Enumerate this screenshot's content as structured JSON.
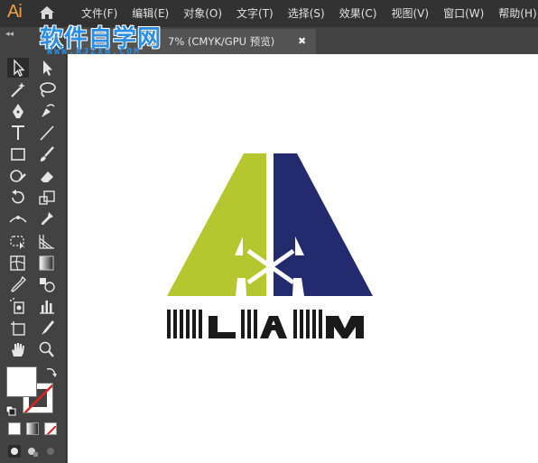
{
  "app": {
    "logo_text": "Ai"
  },
  "menu": {
    "items": [
      "文件(F)",
      "编辑(E)",
      "对象(O)",
      "文字(T)",
      "选择(S)",
      "效果(C)",
      "视图(V)",
      "窗口(W)",
      "帮助(H)"
    ]
  },
  "watermark": {
    "title": "软件自学网",
    "url": "WWW.RJZXW.COM"
  },
  "document_tab": {
    "title": "7% (CMYK/GPU 预览)",
    "close": "✖"
  },
  "panel": {
    "collapse": "◂◂"
  },
  "logo_artwork": {
    "text": "LIAM",
    "colors": {
      "green": "#b5c62e",
      "navy": "#232a6e",
      "black": "#1a1a1a"
    }
  },
  "tools": [
    "selection-tool",
    "direct-selection-tool",
    "magic-wand-tool",
    "lasso-tool",
    "pen-tool",
    "curvature-tool",
    "type-tool",
    "line-segment-tool",
    "rectangle-tool",
    "paintbrush-tool",
    "shaper-tool",
    "eraser-tool",
    "rotate-tool",
    "scale-tool",
    "width-tool",
    "puppet-warp-tool",
    "free-transform-tool",
    "perspective-grid-tool",
    "mesh-tool",
    "gradient-tool",
    "eyedropper-tool",
    "blend-tool",
    "symbol-sprayer-tool",
    "column-graph-tool",
    "artboard-tool",
    "slice-tool",
    "hand-tool",
    "zoom-tool"
  ]
}
